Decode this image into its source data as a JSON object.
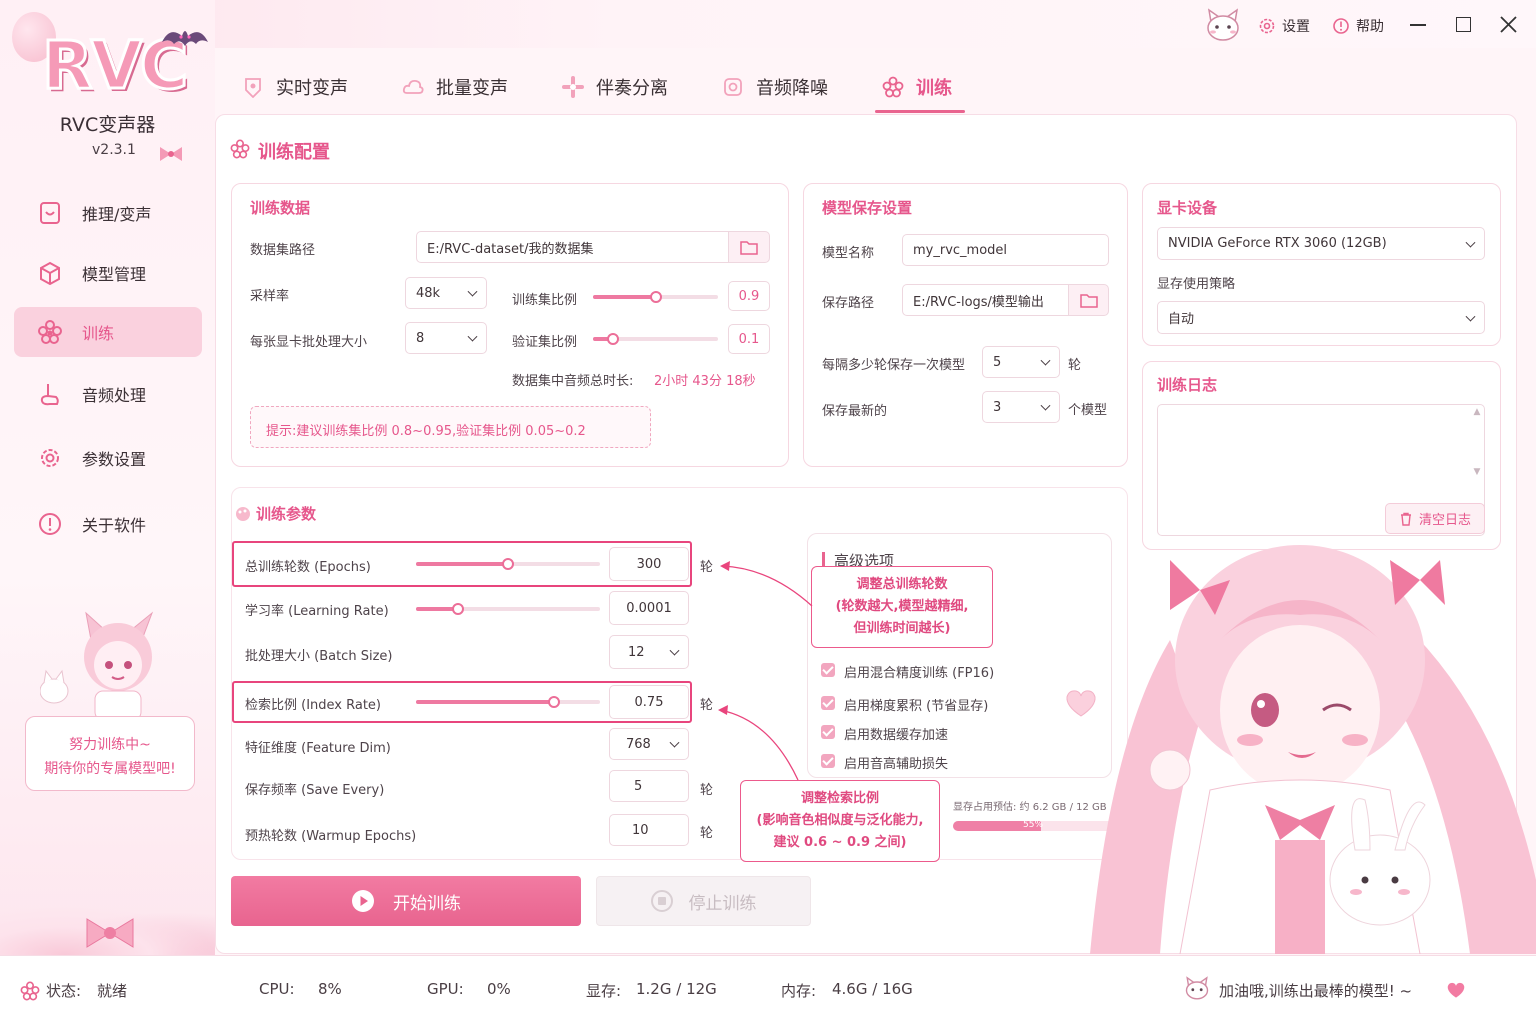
{
  "app": {
    "logo": "RVC",
    "title": "RVC变声器",
    "version": "v2.3.1"
  },
  "titlebar": {
    "settings": "设置",
    "help": "帮助"
  },
  "tabs": [
    {
      "label": "实时变声"
    },
    {
      "label": "批量变声"
    },
    {
      "label": "伴奏分离"
    },
    {
      "label": "音频降噪"
    },
    {
      "label": "训练",
      "active": true
    }
  ],
  "sidebar": {
    "items": [
      {
        "label": "推理/变声"
      },
      {
        "label": "模型管理"
      },
      {
        "label": "训练",
        "active": true
      },
      {
        "label": "音频处理"
      },
      {
        "label": "参数设置"
      },
      {
        "label": "关于软件"
      }
    ],
    "mascot_msg_1": "努力训练中~",
    "mascot_msg_2": "期待你的专属模型吧!"
  },
  "page_title": "训练配置",
  "training_data": {
    "title": "训练数据",
    "dataset_label": "数据集路径",
    "dataset_value": "E:/RVC-dataset/我的数据集",
    "sample_rate_label": "采样率",
    "sample_rate_value": "48k",
    "train_ratio_label": "训练集比例",
    "train_ratio_value": "0.9",
    "batch_per_gpu_label": "每张显卡批处理大小",
    "batch_per_gpu_value": "8",
    "val_ratio_label": "验证集比例",
    "val_ratio_value": "0.1",
    "duration_label": "数据集中音频总时长:",
    "duration_value": "2小时 43分 18秒",
    "hint": "提示:建议训练集比例 0.8~0.95,验证集比例 0.05~0.2"
  },
  "model_save": {
    "title": "模型保存设置",
    "name_label": "模型名称",
    "name_value": "my_rvc_model",
    "path_label": "保存路径",
    "path_value": "E:/RVC-logs/模型输出",
    "every_label": "每隔多少轮保存一次模型",
    "every_value": "5",
    "every_unit": "轮",
    "keep_label": "保存最新的",
    "keep_value": "3",
    "keep_unit": "个模型"
  },
  "gpu": {
    "title": "显卡设备",
    "device": "NVIDIA GeForce RTX 3060 (12GB)",
    "mem_strategy_label": "显存使用策略",
    "mem_strategy": "自动"
  },
  "log": {
    "title": "训练日志",
    "clear": "清空日志"
  },
  "params": {
    "title": "训练参数",
    "epochs_label": "总训练轮数 (Epochs)",
    "epochs_value": "300",
    "epochs_unit": "轮",
    "epochs_level": 0.5,
    "lr_label": "学习率 (Learning Rate)",
    "lr_value": "0.0001",
    "lr_level": 0.23,
    "batch_label": "批处理大小 (Batch Size)",
    "batch_value": "12",
    "index_label": "检索比例 (Index Rate)",
    "index_value": "0.75",
    "index_unit": "轮",
    "index_level": 0.75,
    "feat_label": "特征维度 (Feature Dim)",
    "feat_value": "768",
    "save_every_label": "保存频率 (Save Every)",
    "save_every_value": "5",
    "save_every_unit": "轮",
    "warmup_label": "预热轮数 (Warmup Epochs)",
    "warmup_value": "10",
    "warmup_unit": "轮"
  },
  "advanced": {
    "title": "高级选项",
    "options": [
      {
        "label": "启用混合精度训练 (FP16)",
        "checked": true
      },
      {
        "label": "启用梯度累积 (节省显存)",
        "checked": true
      },
      {
        "label": "启用数据缓存加速",
        "checked": true
      },
      {
        "label": "启用音高辅助损失",
        "checked": true
      }
    ],
    "vram_estimate_label": "显存占用预估: 约 6.2 GB / 12 GB",
    "vram_percent": "55%",
    "vram_level": 0.55
  },
  "callouts": {
    "epochs": [
      "调整总训练轮数",
      "(轮数越大,模型越精细,",
      "但训练时间越长)"
    ],
    "index": [
      "调整检索比例",
      "(影响音色相似度与泛化能力,",
      "建议 0.6 ~ 0.9 之间)"
    ]
  },
  "actions": {
    "start": "开始训练",
    "stop": "停止训练"
  },
  "status": {
    "state_label": "状态:",
    "state_value": "就绪",
    "cpu_label": "CPU:",
    "cpu_value": "8%",
    "gpu_label": "GPU:",
    "gpu_value": "0%",
    "vram_label": "显存:",
    "vram_value": "1.2G / 12G",
    "ram_label": "内存:",
    "ram_value": "4.6G / 16G",
    "cheer": "加油哦,训练出最棒的模型! ~"
  },
  "colors": {
    "accent": "#e6578c",
    "accent_light": "#f6c9d8",
    "bg": "#fff5f8"
  }
}
